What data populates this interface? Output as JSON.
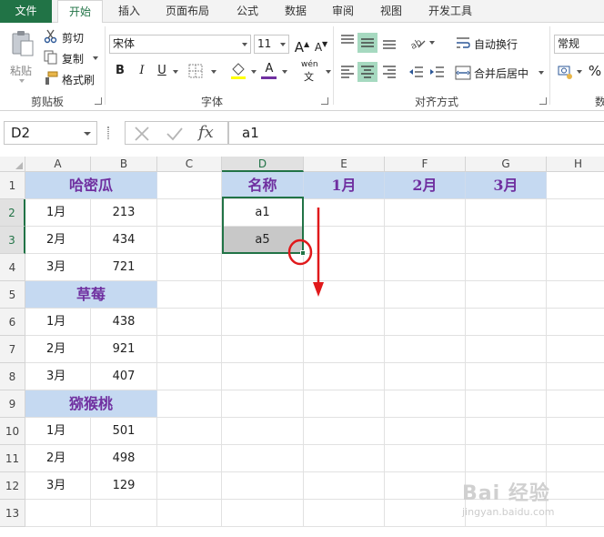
{
  "ribbon_tabs": [
    "文件",
    "开始",
    "插入",
    "页面布局",
    "公式",
    "数据",
    "审阅",
    "视图",
    "开发工具"
  ],
  "clipboard": {
    "paste": "粘贴",
    "cut": "剪切",
    "copy": "复制",
    "format_painter": "格式刷",
    "label": "剪贴板"
  },
  "font": {
    "name": "宋体",
    "size": "11",
    "label": "字体",
    "phonetic": "wén"
  },
  "alignment": {
    "wrap": "自动换行",
    "merge": "合并后居中",
    "label": "对齐方式"
  },
  "number": {
    "format": "常规",
    "label_partial": "数"
  },
  "formula_bar": {
    "name_box": "D2",
    "fx": "fx",
    "content": "a1"
  },
  "columns": [
    "A",
    "B",
    "C",
    "D",
    "E",
    "F",
    "G",
    "H"
  ],
  "rows": [
    "1",
    "2",
    "3",
    "4",
    "5",
    "6",
    "7",
    "8",
    "9",
    "10",
    "11",
    "12",
    "13"
  ],
  "groups": [
    {
      "title": "哈密瓜",
      "items": [
        {
          "month": "1月",
          "value": "213"
        },
        {
          "month": "2月",
          "value": "434"
        },
        {
          "month": "3月",
          "value": "721"
        }
      ]
    },
    {
      "title": "草莓",
      "items": [
        {
          "month": "1月",
          "value": "438"
        },
        {
          "month": "2月",
          "value": "921"
        },
        {
          "month": "3月",
          "value": "407"
        }
      ]
    },
    {
      "title": "猕猴桃",
      "items": [
        {
          "month": "1月",
          "value": "501"
        },
        {
          "month": "2月",
          "value": "498"
        },
        {
          "month": "3月",
          "value": "129"
        }
      ]
    }
  ],
  "header_row": [
    "名称",
    "1月",
    "2月",
    "3月"
  ],
  "d_values": [
    "a1",
    "a5"
  ],
  "watermark": {
    "logo": "Bai 经验",
    "url": "jingyan.baidu.com"
  },
  "colors": {
    "accent": "#217346",
    "title_bg": "#c5d9f1",
    "title_text": "#7030a0",
    "selection_fill": "#c8c8c8",
    "annotation": "#e0191b"
  }
}
